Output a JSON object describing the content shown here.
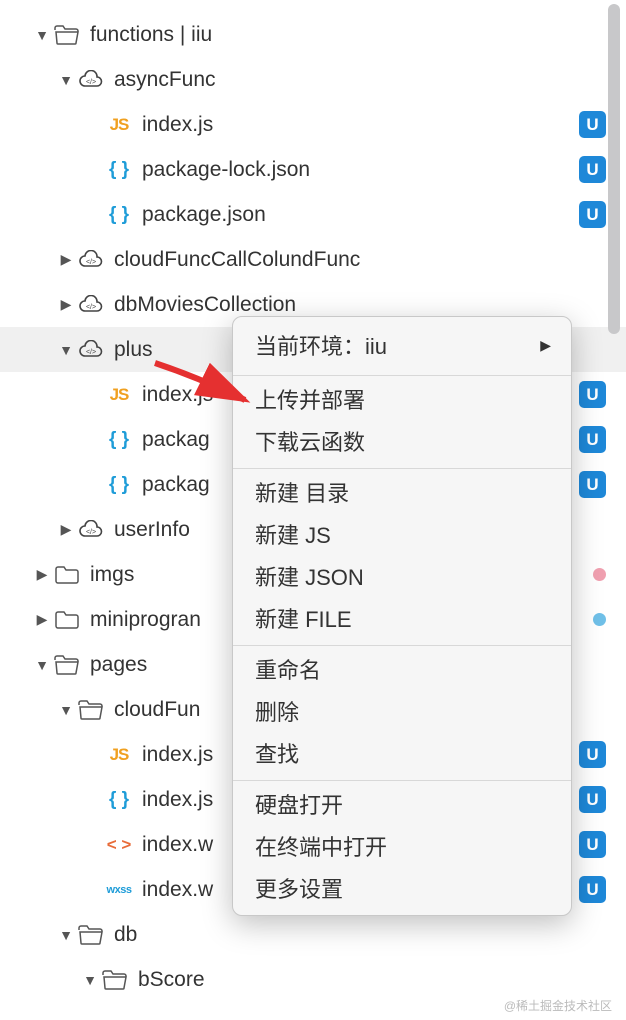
{
  "tree": {
    "root": {
      "caret": "▼",
      "label": "functions | iiu",
      "children": [
        {
          "caret": "▼",
          "type": "cloud",
          "label": "asyncFunc",
          "children": [
            {
              "type": "js",
              "label": "index.js",
              "badge": "U"
            },
            {
              "type": "json",
              "label": "package-lock.json",
              "badge": "U"
            },
            {
              "type": "json",
              "label": "package.json",
              "badge": "U"
            }
          ]
        },
        {
          "caret": "▶",
          "type": "cloud",
          "label": "cloudFuncCallColundFunc"
        },
        {
          "caret": "▶",
          "type": "cloud",
          "label": "dbMoviesCollection"
        },
        {
          "caret": "▼",
          "type": "cloud",
          "label": "plus",
          "selected": true,
          "children": [
            {
              "type": "js",
              "label": "index.js",
              "badge": "U"
            },
            {
              "type": "json",
              "label": "packag",
              "badge": "U"
            },
            {
              "type": "json",
              "label": "packag",
              "badge": "U"
            }
          ]
        },
        {
          "caret": "▶",
          "type": "cloud",
          "label": "userInfo"
        }
      ]
    },
    "siblings": [
      {
        "caret": "▶",
        "type": "folder",
        "label": "imgs",
        "dot": "pink"
      },
      {
        "caret": "▶",
        "type": "folder",
        "label": "miniprogran",
        "dot": "blue"
      },
      {
        "caret": "▼",
        "type": "folder-open",
        "label": "pages",
        "children": [
          {
            "caret": "▼",
            "type": "folder-open",
            "label": "cloudFun",
            "children": [
              {
                "type": "js",
                "label": "index.js",
                "badge": "U"
              },
              {
                "type": "json",
                "label": "index.js",
                "badge": "U"
              },
              {
                "type": "wxml",
                "label": "index.w",
                "badge": "U"
              },
              {
                "type": "wxss",
                "label": "index.w",
                "badge": "U"
              }
            ]
          },
          {
            "caret": "▼",
            "type": "folder-open",
            "label": "db",
            "children": [
              {
                "caret": "▼",
                "type": "folder-open",
                "label": "bScore"
              }
            ]
          }
        ]
      }
    ]
  },
  "context_menu": {
    "header": "当前环境：iiu",
    "groups": [
      [
        "上传并部署",
        "下载云函数"
      ],
      [
        "新建 目录",
        "新建 JS",
        "新建 JSON",
        "新建 FILE"
      ],
      [
        "重命名",
        "删除",
        "查找"
      ],
      [
        "硬盘打开",
        "在终端中打开",
        "更多设置"
      ]
    ]
  },
  "watermark": "@稀土掘金技术社区",
  "icons": {
    "js": "JS",
    "json": "{ }",
    "wxml": "< >",
    "wxss": "wxss"
  }
}
